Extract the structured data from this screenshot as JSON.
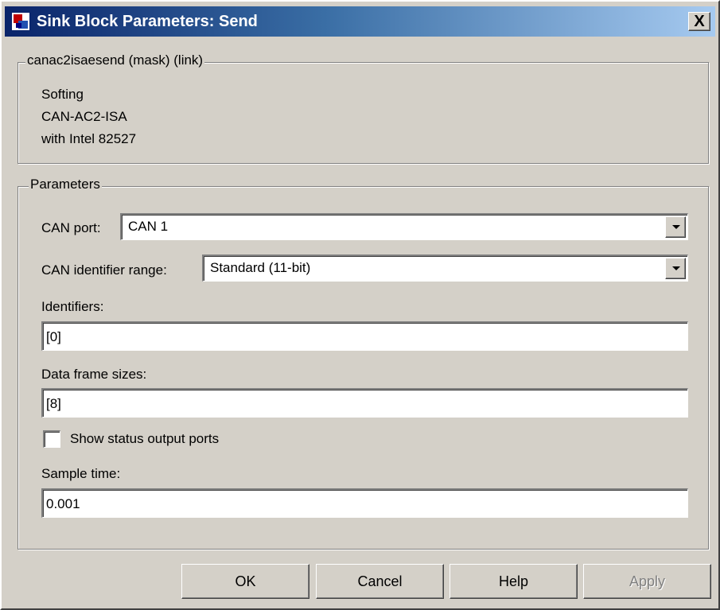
{
  "window": {
    "title": "Sink Block Parameters: Send",
    "close_label": "X"
  },
  "description": {
    "legend": "canac2isaesend (mask) (link)",
    "lines": [
      "Softing",
      "CAN-AC2-ISA",
      "with Intel 82527"
    ]
  },
  "parameters": {
    "legend": "Parameters",
    "can_port": {
      "label": "CAN port:",
      "value": "CAN 1"
    },
    "can_id_range": {
      "label": "CAN identifier range:",
      "value": "Standard (11-bit)"
    },
    "identifiers": {
      "label": "Identifiers:",
      "value": "[0]"
    },
    "data_frame_sizes": {
      "label": "Data frame sizes:",
      "value": "[8]"
    },
    "show_status": {
      "label": "Show status output ports",
      "checked": false
    },
    "sample_time": {
      "label": "Sample time:",
      "value": "0.001"
    }
  },
  "buttons": {
    "ok": "OK",
    "cancel": "Cancel",
    "help": "Help",
    "apply": "Apply"
  }
}
